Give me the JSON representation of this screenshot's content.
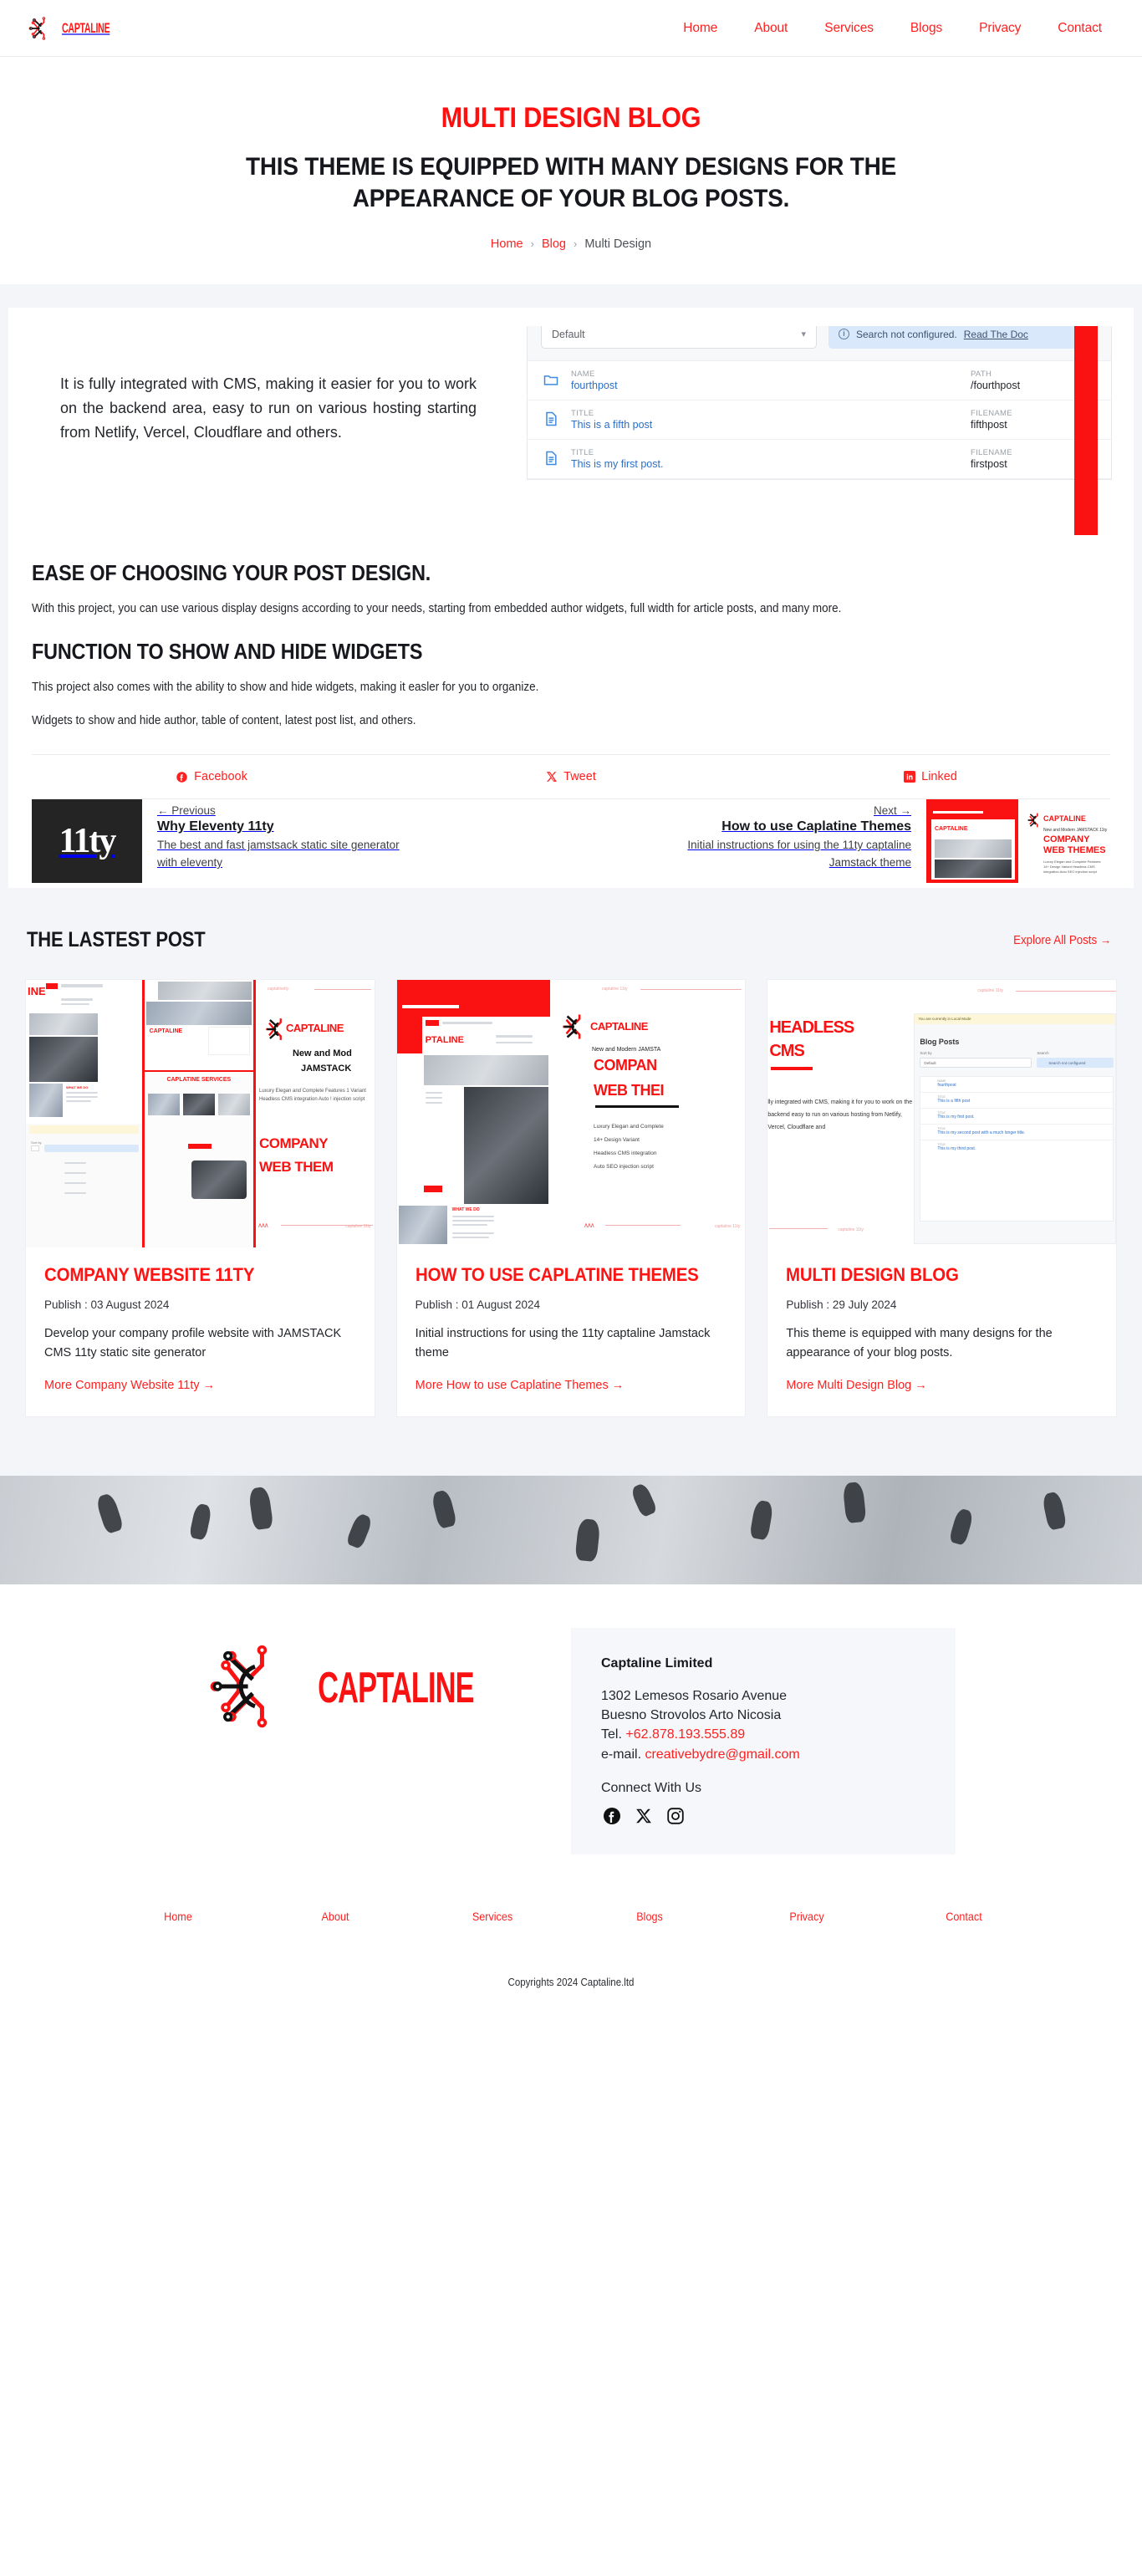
{
  "header": {
    "brand": "CAPTALINE",
    "brand_icon": "captaline-circuit-logo",
    "nav": [
      {
        "label": "Home"
      },
      {
        "label": "About"
      },
      {
        "label": "Services"
      },
      {
        "label": "Blogs"
      },
      {
        "label": "Privacy"
      },
      {
        "label": "Contact"
      }
    ]
  },
  "hero": {
    "title": "MULTI DESIGN BLOG",
    "subtitle": "THIS THEME IS EQUIPPED WITH MANY DESIGNS FOR THE APPEARANCE OF YOUR BLOG POSTS.",
    "breadcrumb": {
      "home": "Home",
      "sep1": "›",
      "blog": "Blog",
      "sep2": "›",
      "current": "Multi Design"
    }
  },
  "article": {
    "intro": "It is fully integrated with CMS, making it easier for you to work on the backend area, easy to run on various hosting starting from Netlify, Vercel, Cloudflare and others.",
    "cms_shot": {
      "sort_value": "Default",
      "chevron_icon": "chevron-down-icon",
      "info_icon": "info-circle-icon",
      "search_notice": "Search not configured.",
      "search_link": "Read The Doc",
      "rows": [
        {
          "icon": "folder-icon",
          "label": "NAME",
          "value": "fourthpost",
          "meta_label": "PATH",
          "meta_value": "/fourthpost"
        },
        {
          "icon": "file-icon",
          "label": "TITLE",
          "value": "This is a fifth post",
          "meta_label": "FILENAME",
          "meta_value": "fifthpost"
        },
        {
          "icon": "file-icon",
          "label": "TITLE",
          "value": "This is my first post.",
          "meta_label": "FILENAME",
          "meta_value": "firstpost"
        }
      ]
    },
    "sections": [
      {
        "heading": "EASE OF CHOOSING YOUR POST DESIGN.",
        "paragraphs": [
          "With this project, you can use various display designs according to your needs, starting from embedded author widgets, full width for article posts, and many more."
        ]
      },
      {
        "heading": "FUNCTION TO SHOW AND HIDE WIDGETS",
        "paragraphs": [
          "This project also comes with the ability to show and hide widgets, making it easler for you to organize.",
          "Widgets to show and hide author, table of content, latest post list, and others."
        ]
      }
    ],
    "share": [
      {
        "label": "Facebook",
        "icon": "facebook-icon"
      },
      {
        "label": "Tweet",
        "icon": "x-twitter-icon"
      },
      {
        "label": "Linked",
        "icon": "linkedin-icon"
      }
    ],
    "prev": {
      "kicker": "← Previous",
      "title": "Why Eleventy 11ty",
      "desc": "The best and fast jamstsack static site generator with eleventy",
      "thumb_text": "11ty"
    },
    "next": {
      "kicker": "Next →",
      "title": "How to use Caplatine Themes",
      "desc": "Initial instructions for using the 11ty captaline Jamstack theme",
      "thumb_brand": "CAPTALINE",
      "thumb_line1": "New and Modern JAMSTACK 11ty",
      "thumb_line2": "COMPANY",
      "thumb_line3": "WEB THEMES",
      "thumb_bullets": "Luxury Elegan and Complete Features 14+ Design Variant Headless CMS integration Auto SEO injection script"
    }
  },
  "latest": {
    "heading": "THE LASTEST POST",
    "explore": "Explore All Posts →",
    "cards": [
      {
        "title": "COMPANY WEBSITE 11TY",
        "date": "Publish : 03 August 2024",
        "desc": "Develop your company profile website with JAMSTACK CMS 11ty static site generator",
        "more": "More Company Website 11ty →",
        "thumb": {
          "brand": "CAPTALINE",
          "kicker": "captalineIty",
          "line1": "New and Mod",
          "line2": "JAMSTACK",
          "body": "Luxury Elegan and Complete Features 1 Variant Headless CMS integration Auto ! injection script",
          "big1": "COMPANY",
          "big2": "WEB THEM",
          "services": "CAPLATINE SERVICES",
          "footer": "captaline 11ty"
        }
      },
      {
        "title": "HOW TO USE CAPLATINE THEMES",
        "date": "Publish : 01 August 2024",
        "desc": "Initial instructions for using the 11ty captaline Jamstack theme",
        "more": "More How to use Caplatine Themes →",
        "thumb": {
          "brand": "CAPTALINE",
          "kicker": "captaline 11ty",
          "line1": "New and Modern JAMSTA",
          "big1": "COMPAN",
          "big2": "WEB THEI",
          "bullets": [
            "Luxury Elegan and Complete",
            "14+ Design Variant",
            "Headless CMS integration",
            "Auto SEO injection script"
          ],
          "nav_brand": "PTALINE",
          "whatwedo": "WHAT WE DO",
          "footer": "captaline 11ty"
        }
      },
      {
        "title": "MULTI DESIGN BLOG",
        "date": "Publish : 29 July 2024",
        "desc": "This theme is equipped with many designs for the appearance of your blog posts.",
        "more": "More Multi Design Blog →",
        "thumb": {
          "headline1": "HEADLESS",
          "headline2": "CMS",
          "body": "lly integrated with CMS, making it for you to work on the backend easy to run on various hosting from Netlify, Vercel, Cloudflare and",
          "kicker": "captaline 11ty",
          "panel_mode": "You are currently in Local Mode",
          "panel_title": "Blog Posts",
          "sort_label": "Sort by",
          "sort_value": "Default",
          "search_label": "Search",
          "search_note": "Search not configured",
          "rows": [
            {
              "label": "NAME",
              "value": "fourthpost"
            },
            {
              "label": "TITLE",
              "value": "This is a fifth post"
            },
            {
              "label": "TITLE",
              "value": "This is my first post."
            },
            {
              "label": "TITLE",
              "value": "This is my second post with a much longer title."
            },
            {
              "label": "TITLE",
              "value": "This is my third post."
            }
          ],
          "footer": "captaline 11ty"
        }
      }
    ]
  },
  "footer": {
    "logo_text": "CAPTALINE",
    "logo_icon": "captaline-circuit-logo",
    "company": "Captaline Limited",
    "address_line1": "1302 Lemesos Rosario Avenue",
    "address_line2": "Buesno Strovolos Arto Nicosia",
    "tel_label": "Tel.",
    "tel_value": "+62.878.193.555.89",
    "email_label": "e-mail.",
    "email_value": "creativebydre@gmail.com",
    "connect": "Connect With Us",
    "socials": [
      {
        "icon": "facebook-icon",
        "name": "facebook"
      },
      {
        "icon": "x-twitter-icon",
        "name": "x-twitter"
      },
      {
        "icon": "instagram-icon",
        "name": "instagram"
      }
    ],
    "nav": [
      {
        "label": "Home"
      },
      {
        "label": "About"
      },
      {
        "label": "Services"
      },
      {
        "label": "Blogs"
      },
      {
        "label": "Privacy"
      },
      {
        "label": "Contact"
      }
    ],
    "copyright": "Copyrights 2024 Captaline.ltd"
  },
  "colors": {
    "brand_red": "#ff2020",
    "title_red": "#ff1010",
    "dark": "#16181d",
    "band_bg": "#f3f5f8"
  }
}
